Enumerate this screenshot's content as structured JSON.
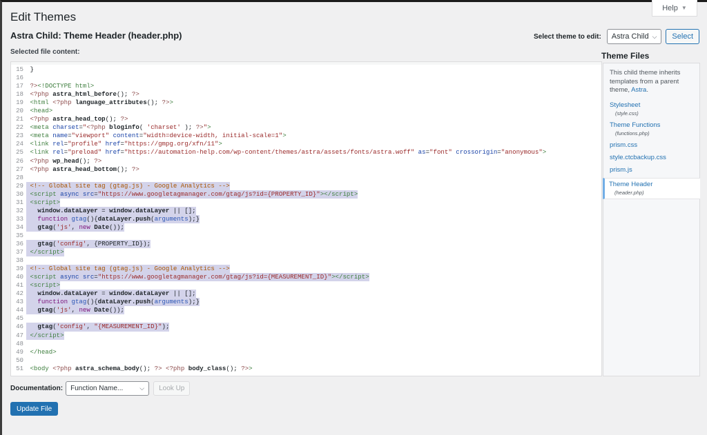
{
  "help": {
    "label": "Help",
    "caret": "▼"
  },
  "header": {
    "title": "Edit Themes",
    "file_title": "Astra Child: Theme Header (header.php)",
    "selected_label": "Selected file content:"
  },
  "theme_select": {
    "label": "Select theme to edit:",
    "value": "Astra Child",
    "button": "Select"
  },
  "sidebar": {
    "title": "Theme Files",
    "description_prefix": "This child theme inherits templates from a parent theme, ",
    "parent_link": "Astra",
    "description_suffix": ".",
    "files": [
      {
        "name": "Stylesheet",
        "sub": "(style.css)"
      },
      {
        "name": "Theme Functions",
        "sub": "(functions.php)"
      },
      {
        "name": "prism.css",
        "sub": ""
      },
      {
        "name": "style.ctcbackup.css",
        "sub": ""
      },
      {
        "name": "prism.js",
        "sub": ""
      },
      {
        "name": "Theme Header",
        "sub": "(header.php)",
        "active": true
      }
    ]
  },
  "editor": {
    "lines": [
      {
        "n": "15",
        "html": "<span class=\"txt\">}</span>"
      },
      {
        "n": "16",
        "html": ""
      },
      {
        "n": "17",
        "html": "<span class=\"php\">?&gt;</span><span class=\"tag\">&lt;!DOCTYPE html&gt;</span>"
      },
      {
        "n": "18",
        "html": "<span class=\"php\">&lt;?php</span> <span class=\"bold\">astra_html_before</span>(); <span class=\"php\">?&gt;</span>"
      },
      {
        "n": "19",
        "html": "<span class=\"tag\">&lt;html</span> <span class=\"php\">&lt;?php</span> <span class=\"bold\">language_attributes</span>(); <span class=\"php\">?&gt;</span><span class=\"tag\">&gt;</span>"
      },
      {
        "n": "20",
        "html": "<span class=\"tag\">&lt;head&gt;</span>"
      },
      {
        "n": "21",
        "html": "<span class=\"php\">&lt;?php</span> <span class=\"bold\">astra_head_top</span>(); <span class=\"php\">?&gt;</span>"
      },
      {
        "n": "22",
        "html": "<span class=\"tag\">&lt;meta</span> <span class=\"attr\">charset</span>=<span class=\"str\">\"</span><span class=\"php\">&lt;?php</span> <span class=\"bold\">bloginfo</span>( <span class=\"str\">'charset'</span> ); <span class=\"php\">?&gt;</span><span class=\"str\">\"</span><span class=\"tag\">&gt;</span>"
      },
      {
        "n": "23",
        "html": "<span class=\"tag\">&lt;meta</span> <span class=\"attr\">name</span>=<span class=\"str\">\"viewport\"</span> <span class=\"attr\">content</span>=<span class=\"str\">\"width=device-width, initial-scale=1\"</span><span class=\"tag\">&gt;</span>"
      },
      {
        "n": "24",
        "html": "<span class=\"tag\">&lt;link</span> <span class=\"attr\">rel</span>=<span class=\"str\">\"profile\"</span> <span class=\"attr\">href</span>=<span class=\"str\">\"https://gmpg.org/xfn/11\"</span><span class=\"tag\">&gt;</span>"
      },
      {
        "n": "25",
        "html": "<span class=\"tag\">&lt;link</span> <span class=\"attr\">rel</span>=<span class=\"str\">\"preload\"</span> <span class=\"attr\">href</span>=<span class=\"str\">\"https://automation-help.com/wp-content/themes/astra/assets/fonts/astra.woff\"</span> <span class=\"attr\">as</span>=<span class=\"str\">\"font\"</span> <span class=\"attr\">crossorigin</span>=<span class=\"str\">\"anonymous\"</span><span class=\"tag\">&gt;</span>"
      },
      {
        "n": "26",
        "html": "<span class=\"php\">&lt;?php</span> <span class=\"bold\">wp_head</span>(); <span class=\"php\">?&gt;</span>"
      },
      {
        "n": "27",
        "html": "<span class=\"php\">&lt;?php</span> <span class=\"bold\">astra_head_bottom</span>(); <span class=\"php\">?&gt;</span>"
      },
      {
        "n": "28",
        "html": ""
      },
      {
        "n": "29",
        "hl": true,
        "html": "<span class=\"cmt\">&lt;!-- Global site tag (gtag.js) - Google Analytics --&gt;</span>"
      },
      {
        "n": "30",
        "hl": true,
        "html": "<span class=\"tag\">&lt;script</span> <span class=\"attr\">async</span> <span class=\"attr\">src</span>=<span class=\"str\">\"https://www.googletagmanager.com/gtag/js?id={PROPERTY_ID}\"</span><span class=\"tag\">&gt;&lt;/script&gt;</span>"
      },
      {
        "n": "31",
        "hl": true,
        "html": "<span class=\"tag\">&lt;script&gt;</span>"
      },
      {
        "n": "32",
        "hl": true,
        "html": "  <span class=\"bold\">window.dataLayer</span> = <span class=\"bold\">window.dataLayer</span> || [];"
      },
      {
        "n": "33",
        "hl": true,
        "html": "  <span class=\"kw\">function</span> <span class=\"fn\">gtag</span>(){<span class=\"bold\">dataLayer.push</span>(<span class=\"fn\">arguments</span>);}"
      },
      {
        "n": "34",
        "hl": true,
        "html": "  <span class=\"bold\">gtag</span>(<span class=\"str\">'js'</span>, <span class=\"kw\">new</span> <span class=\"bold\">Date</span>());"
      },
      {
        "n": "35",
        "html": ""
      },
      {
        "n": "36",
        "hl": true,
        "html": "  <span class=\"bold\">gtag</span>(<span class=\"str\">'config'</span>, {PROPERTY_ID});"
      },
      {
        "n": "37",
        "hl": true,
        "html": "<span class=\"tag\">&lt;/script&gt;</span>"
      },
      {
        "n": "38",
        "html": ""
      },
      {
        "n": "39",
        "hl": true,
        "html": "<span class=\"cmt\">&lt;!-- Global site tag (gtag.js) - Google Analytics --&gt;</span>"
      },
      {
        "n": "40",
        "hl": true,
        "html": "<span class=\"tag\">&lt;script</span> <span class=\"attr\">async</span> <span class=\"attr\">src</span>=<span class=\"str\">\"https://www.googletagmanager.com/gtag/js?id={MEASUREMENT_ID}\"</span><span class=\"tag\">&gt;&lt;/script&gt;</span>"
      },
      {
        "n": "41",
        "hl": true,
        "html": "<span class=\"tag\">&lt;script&gt;</span>"
      },
      {
        "n": "42",
        "hl": true,
        "html": "  <span class=\"bold\">window.dataLayer</span> = <span class=\"bold\">window.dataLayer</span> || [];"
      },
      {
        "n": "43",
        "hl": true,
        "html": "  <span class=\"kw\">function</span> <span class=\"fn\">gtag</span>(){<span class=\"bold\">dataLayer.push</span>(<span class=\"fn\">arguments</span>);}"
      },
      {
        "n": "44",
        "hl": true,
        "html": "  <span class=\"bold\">gtag</span>(<span class=\"str\">'js'</span>, <span class=\"kw\">new</span> <span class=\"bold\">Date</span>());"
      },
      {
        "n": "45",
        "html": ""
      },
      {
        "n": "46",
        "hl": true,
        "html": "  <span class=\"bold\">gtag</span>(<span class=\"str\">'config'</span>, <span class=\"str\">\"{MEASUREMENT_ID}\"</span>);"
      },
      {
        "n": "47",
        "hl": true,
        "html": "<span class=\"tag\">&lt;/script&gt;</span>"
      },
      {
        "n": "48",
        "html": ""
      },
      {
        "n": "49",
        "html": "<span class=\"tag\">&lt;/head&gt;</span>"
      },
      {
        "n": "50",
        "html": ""
      },
      {
        "n": "51",
        "html": "<span class=\"tag\">&lt;body</span> <span class=\"php\">&lt;?php</span> <span class=\"bold\">astra_schema_body</span>(); <span class=\"php\">?&gt;</span> <span class=\"php\">&lt;?php</span> <span class=\"bold\">body_class</span>(); <span class=\"php\">?&gt;</span><span class=\"tag\">&gt;</span>"
      }
    ]
  },
  "documentation": {
    "label": "Documentation:",
    "select_value": "Function Name...",
    "lookup_button": "Look Up"
  },
  "update_button": "Update File",
  "colors": {
    "accent": "#2271b1",
    "selection": "#d3d3ea",
    "active_file_border": "#72aee6"
  }
}
